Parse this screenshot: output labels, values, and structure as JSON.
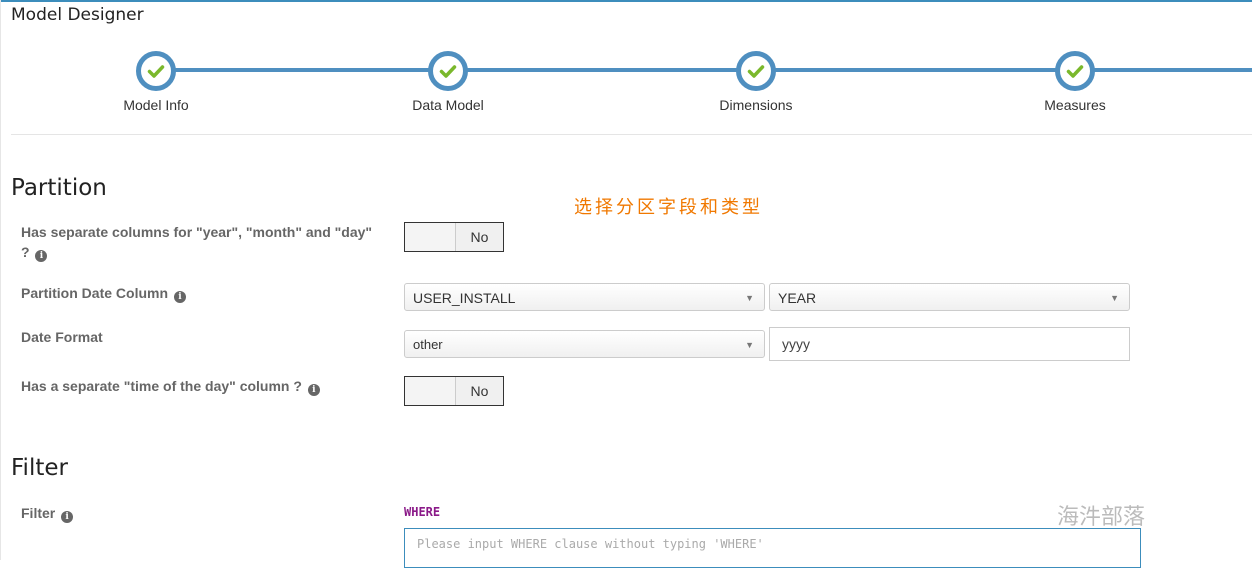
{
  "page": {
    "title": "Model Designer"
  },
  "wizard": {
    "color": "#4f8fc0",
    "check_color": "#7ab82c",
    "steps": [
      {
        "label": "Model Info",
        "status": "complete"
      },
      {
        "label": "Data Model",
        "status": "complete"
      },
      {
        "label": "Dimensions",
        "status": "complete"
      },
      {
        "label": "Measures",
        "status": "complete"
      }
    ]
  },
  "annotation": {
    "text": "选择分区字段和类型",
    "color": "#f07800"
  },
  "partition": {
    "title": "Partition",
    "separate_columns": {
      "label_line1": "Has separate columns for \"year\", \"month\" and \"day\"",
      "label_line2": "?",
      "toggle_value": "No"
    },
    "date_column": {
      "label": "Partition Date Column",
      "column_value": "USER_INSTALL",
      "type_value": "YEAR"
    },
    "date_format": {
      "label": "Date Format",
      "format_value": "other",
      "custom_value": "yyyy"
    },
    "time_of_day": {
      "label": "Has a separate \"time of the day\" column ?",
      "toggle_value": "No"
    }
  },
  "filter": {
    "title": "Filter",
    "label": "Filter",
    "where_keyword": "WHERE",
    "placeholder": "Please input WHERE clause without typing 'WHERE'"
  },
  "watermark": {
    "text": "海汼部落"
  },
  "icons": {
    "info": "i",
    "caret": "▼"
  }
}
